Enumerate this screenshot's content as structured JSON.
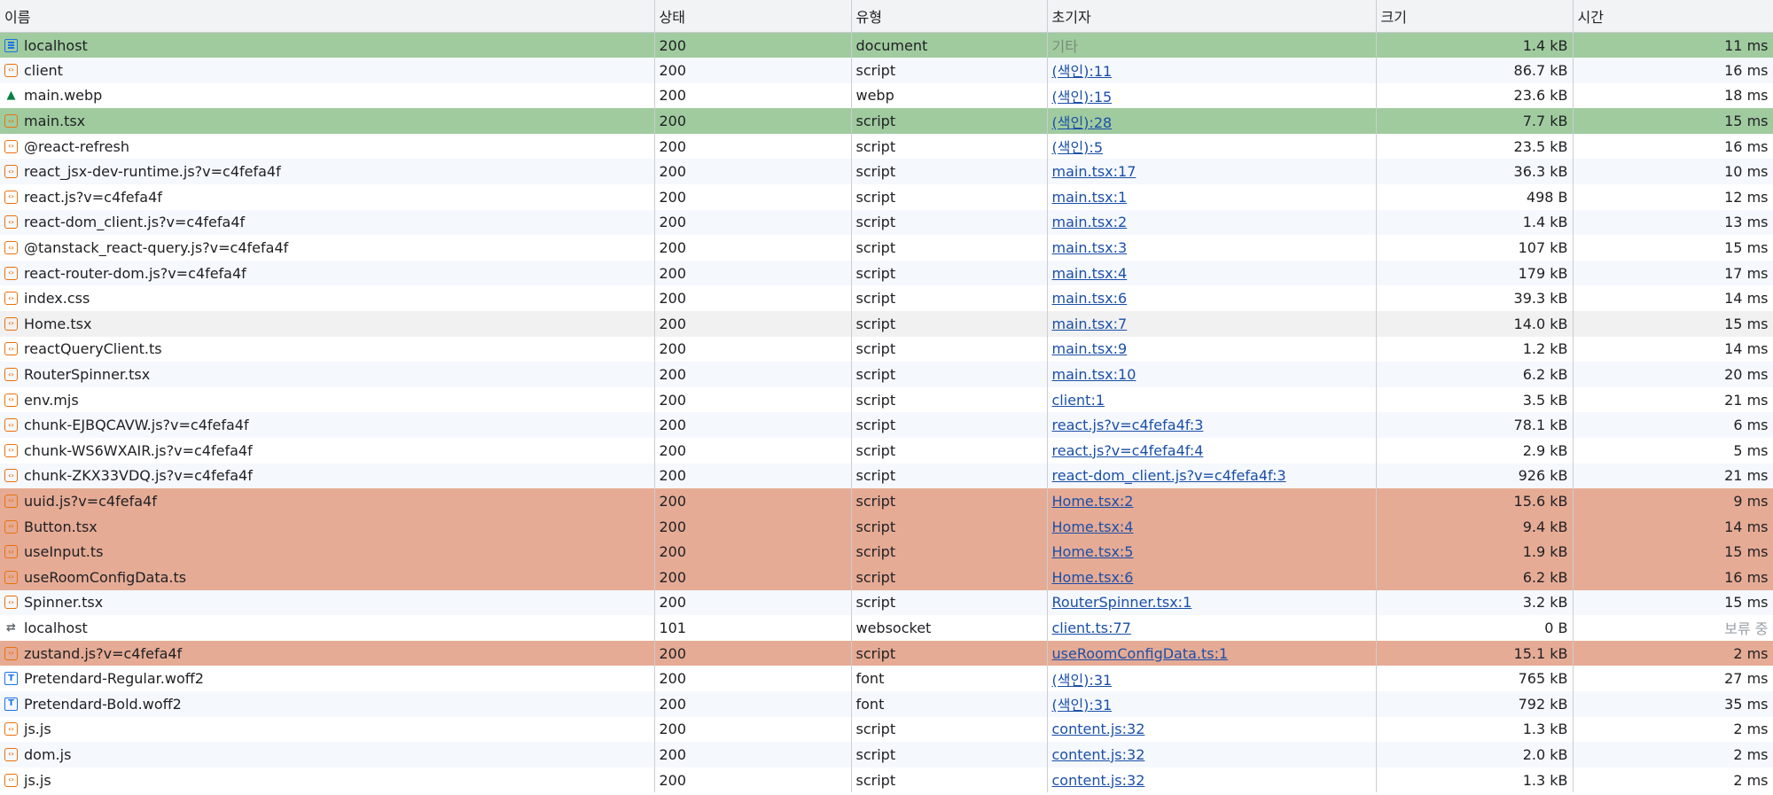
{
  "headers": {
    "name": "이름",
    "status": "상태",
    "type": "유형",
    "initiator": "초기자",
    "size": "크기",
    "time": "시간"
  },
  "rows": [
    {
      "name": "localhost",
      "status": "200",
      "type": "document",
      "initiator": "기타",
      "initiator_link": false,
      "size": "1.4 kB",
      "time": "11 ms",
      "icon": "document-icon",
      "state": "sel"
    },
    {
      "name": "client",
      "status": "200",
      "type": "script",
      "initiator": "(색인):11",
      "initiator_link": true,
      "size": "86.7 kB",
      "time": "16 ms",
      "icon": "script-icon",
      "state": "alt"
    },
    {
      "name": "main.webp",
      "status": "200",
      "type": "webp",
      "initiator": "(색인):15",
      "initiator_link": true,
      "size": "23.6 kB",
      "time": "18 ms",
      "icon": "image-icon",
      "state": ""
    },
    {
      "name": "main.tsx",
      "status": "200",
      "type": "script",
      "initiator": "(색인):28",
      "initiator_link": true,
      "size": "7.7 kB",
      "time": "15 ms",
      "icon": "script-icon",
      "state": "sel"
    },
    {
      "name": "@react-refresh",
      "status": "200",
      "type": "script",
      "initiator": "(색인):5",
      "initiator_link": true,
      "size": "23.5 kB",
      "time": "16 ms",
      "icon": "script-icon",
      "state": ""
    },
    {
      "name": "react_jsx-dev-runtime.js?v=c4fefa4f",
      "status": "200",
      "type": "script",
      "initiator": "main.tsx:17",
      "initiator_link": true,
      "size": "36.3 kB",
      "time": "10 ms",
      "icon": "script-icon",
      "state": "alt"
    },
    {
      "name": "react.js?v=c4fefa4f",
      "status": "200",
      "type": "script",
      "initiator": "main.tsx:1",
      "initiator_link": true,
      "size": "498 B",
      "time": "12 ms",
      "icon": "script-icon",
      "state": ""
    },
    {
      "name": "react-dom_client.js?v=c4fefa4f",
      "status": "200",
      "type": "script",
      "initiator": "main.tsx:2",
      "initiator_link": true,
      "size": "1.4 kB",
      "time": "13 ms",
      "icon": "script-icon",
      "state": "alt"
    },
    {
      "name": "@tanstack_react-query.js?v=c4fefa4f",
      "status": "200",
      "type": "script",
      "initiator": "main.tsx:3",
      "initiator_link": true,
      "size": "107 kB",
      "time": "15 ms",
      "icon": "script-icon",
      "state": ""
    },
    {
      "name": "react-router-dom.js?v=c4fefa4f",
      "status": "200",
      "type": "script",
      "initiator": "main.tsx:4",
      "initiator_link": true,
      "size": "179 kB",
      "time": "17 ms",
      "icon": "script-icon",
      "state": "alt"
    },
    {
      "name": "index.css",
      "status": "200",
      "type": "script",
      "initiator": "main.tsx:6",
      "initiator_link": true,
      "size": "39.3 kB",
      "time": "14 ms",
      "icon": "script-icon",
      "state": ""
    },
    {
      "name": "Home.tsx",
      "status": "200",
      "type": "script",
      "initiator": "main.tsx:7",
      "initiator_link": true,
      "size": "14.0 kB",
      "time": "15 ms",
      "icon": "script-icon",
      "state": "hover"
    },
    {
      "name": "reactQueryClient.ts",
      "status": "200",
      "type": "script",
      "initiator": "main.tsx:9",
      "initiator_link": true,
      "size": "1.2 kB",
      "time": "14 ms",
      "icon": "script-icon",
      "state": ""
    },
    {
      "name": "RouterSpinner.tsx",
      "status": "200",
      "type": "script",
      "initiator": "main.tsx:10",
      "initiator_link": true,
      "size": "6.2 kB",
      "time": "20 ms",
      "icon": "script-icon",
      "state": "alt"
    },
    {
      "name": "env.mjs",
      "status": "200",
      "type": "script",
      "initiator": "client:1",
      "initiator_link": true,
      "size": "3.5 kB",
      "time": "21 ms",
      "icon": "script-icon",
      "state": ""
    },
    {
      "name": "chunk-EJBQCAVW.js?v=c4fefa4f",
      "status": "200",
      "type": "script",
      "initiator": "react.js?v=c4fefa4f:3",
      "initiator_link": true,
      "size": "78.1 kB",
      "time": "6 ms",
      "icon": "script-icon",
      "state": "alt"
    },
    {
      "name": "chunk-WS6WXAIR.js?v=c4fefa4f",
      "status": "200",
      "type": "script",
      "initiator": "react.js?v=c4fefa4f:4",
      "initiator_link": true,
      "size": "2.9 kB",
      "time": "5 ms",
      "icon": "script-icon",
      "state": ""
    },
    {
      "name": "chunk-ZKX33VDQ.js?v=c4fefa4f",
      "status": "200",
      "type": "script",
      "initiator": "react-dom_client.js?v=c4fefa4f:3",
      "initiator_link": true,
      "size": "926 kB",
      "time": "21 ms",
      "icon": "script-icon",
      "state": "alt"
    },
    {
      "name": "uuid.js?v=c4fefa4f",
      "status": "200",
      "type": "script",
      "initiator": "Home.tsx:2",
      "initiator_link": true,
      "size": "15.6 kB",
      "time": "9 ms",
      "icon": "script-icon",
      "state": "hl"
    },
    {
      "name": "Button.tsx",
      "status": "200",
      "type": "script",
      "initiator": "Home.tsx:4",
      "initiator_link": true,
      "size": "9.4 kB",
      "time": "14 ms",
      "icon": "script-icon",
      "state": "hl"
    },
    {
      "name": "useInput.ts",
      "status": "200",
      "type": "script",
      "initiator": "Home.tsx:5",
      "initiator_link": true,
      "size": "1.9 kB",
      "time": "15 ms",
      "icon": "script-icon",
      "state": "hl"
    },
    {
      "name": "useRoomConfigData.ts",
      "status": "200",
      "type": "script",
      "initiator": "Home.tsx:6",
      "initiator_link": true,
      "size": "6.2 kB",
      "time": "16 ms",
      "icon": "script-icon",
      "state": "hl"
    },
    {
      "name": "Spinner.tsx",
      "status": "200",
      "type": "script",
      "initiator": "RouterSpinner.tsx:1",
      "initiator_link": true,
      "size": "3.2 kB",
      "time": "15 ms",
      "icon": "script-icon",
      "state": "alt"
    },
    {
      "name": "localhost",
      "status": "101",
      "type": "websocket",
      "initiator": "client.ts:77",
      "initiator_link": true,
      "size": "0 B",
      "time": "보류 중",
      "time_muted": true,
      "icon": "websocket-icon",
      "state": ""
    },
    {
      "name": "zustand.js?v=c4fefa4f",
      "status": "200",
      "type": "script",
      "initiator": "useRoomConfigData.ts:1",
      "initiator_link": true,
      "size": "15.1 kB",
      "time": "2 ms",
      "icon": "script-icon",
      "state": "hl"
    },
    {
      "name": "Pretendard-Regular.woff2",
      "status": "200",
      "type": "font",
      "initiator": "(색인):31",
      "initiator_link": true,
      "size": "765 kB",
      "time": "27 ms",
      "icon": "font-icon",
      "state": ""
    },
    {
      "name": "Pretendard-Bold.woff2",
      "status": "200",
      "type": "font",
      "initiator": "(색인):31",
      "initiator_link": true,
      "size": "792 kB",
      "time": "35 ms",
      "icon": "font-icon",
      "state": "alt"
    },
    {
      "name": "js.js",
      "status": "200",
      "type": "script",
      "initiator": "content.js:32",
      "initiator_link": true,
      "size": "1.3 kB",
      "time": "2 ms",
      "icon": "script-icon",
      "state": ""
    },
    {
      "name": "dom.js",
      "status": "200",
      "type": "script",
      "initiator": "content.js:32",
      "initiator_link": true,
      "size": "2.0 kB",
      "time": "2 ms",
      "icon": "script-icon",
      "state": "alt"
    },
    {
      "name": "js.js",
      "status": "200",
      "type": "script",
      "initiator": "content.js:32",
      "initiator_link": true,
      "size": "1.3 kB",
      "time": "2 ms",
      "icon": "script-icon",
      "state": ""
    }
  ],
  "colors": {
    "selected": "#a0cb9f",
    "highlight": "#e6ab95",
    "link": "#1a4fa8",
    "header_bg": "#f1f3f4"
  }
}
